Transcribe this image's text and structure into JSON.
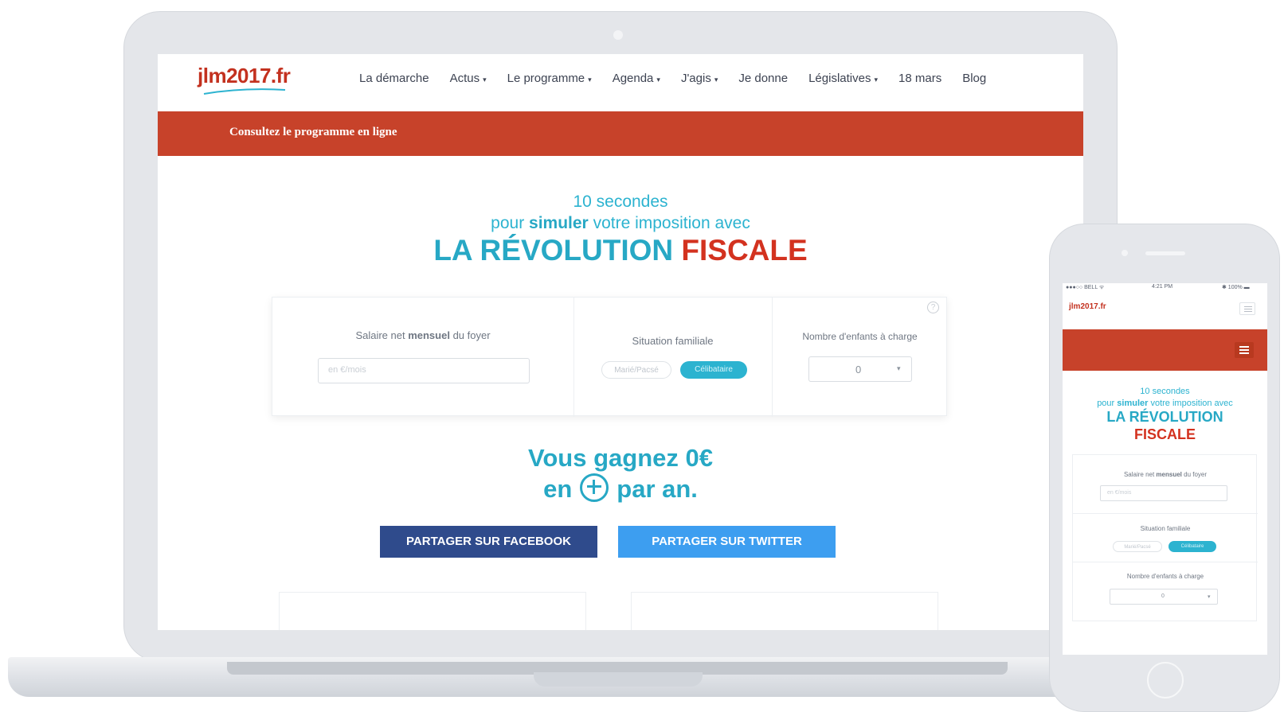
{
  "site": {
    "logo": "jlm2017.fr",
    "nav": [
      {
        "label": "La démarche",
        "dropdown": false
      },
      {
        "label": "Actus",
        "dropdown": true
      },
      {
        "label": "Le programme",
        "dropdown": true
      },
      {
        "label": "Agenda",
        "dropdown": true
      },
      {
        "label": "J'agis",
        "dropdown": true
      },
      {
        "label": "Je donne",
        "dropdown": false
      },
      {
        "label": "Législatives",
        "dropdown": true
      },
      {
        "label": "18 mars",
        "dropdown": false
      },
      {
        "label": "Blog",
        "dropdown": false
      }
    ],
    "caret": "▾",
    "banner_link": "Consultez le programme en ligne"
  },
  "hero": {
    "line1": "10 secondes",
    "line2_pre": "pour ",
    "line2_bold": "simuler",
    "line2_post": " votre imposition avec",
    "title_blue": "LA RÉVOLUTION",
    "title_red": "FISCALE"
  },
  "calculator": {
    "salary": {
      "label_pre": "Salaire net ",
      "label_bold": "mensuel",
      "label_post": " du foyer",
      "placeholder": "en €/mois"
    },
    "family": {
      "label": "Situation familiale",
      "options": [
        "Marié/Pacsé",
        "Célibataire"
      ],
      "selected": "Célibataire"
    },
    "children": {
      "label": "Nombre d'enfants à charge",
      "value": "0"
    },
    "help": "?"
  },
  "result": {
    "line1": "Vous gagnez 0€",
    "line2_pre": "en",
    "line2_post": "par an."
  },
  "share": {
    "facebook": "PARTAGER SUR FACEBOOK",
    "twitter": "PARTAGER SUR TWITTER"
  },
  "colors": {
    "brand_red": "#c7422a",
    "accent_blue": "#27a8c5",
    "facebook": "#2f4b8c",
    "twitter": "#3d9ef0"
  },
  "phone": {
    "status_left": "●●●○○ BELL ᯤ",
    "status_center": "4:21 PM",
    "status_right": "✱ 100% ▬",
    "logo": "jlm2017.fr",
    "line1": "10 secondes",
    "line2_pre": "pour ",
    "line2_bold": "simuler",
    "line2_post": " votre imposition avec",
    "title_blue": "LA RÉVOLUTION",
    "title_red": "FISCALE",
    "salary_pre": "Salaire net ",
    "salary_bold": "mensuel",
    "salary_post": " du foyer",
    "salary_placeholder": "en €/mois",
    "family_label": "Situation familiale",
    "family_options": [
      "Marié/Pacsé",
      "Célibataire"
    ],
    "children_label": "Nombre d'enfants à charge",
    "children_value": "0"
  }
}
